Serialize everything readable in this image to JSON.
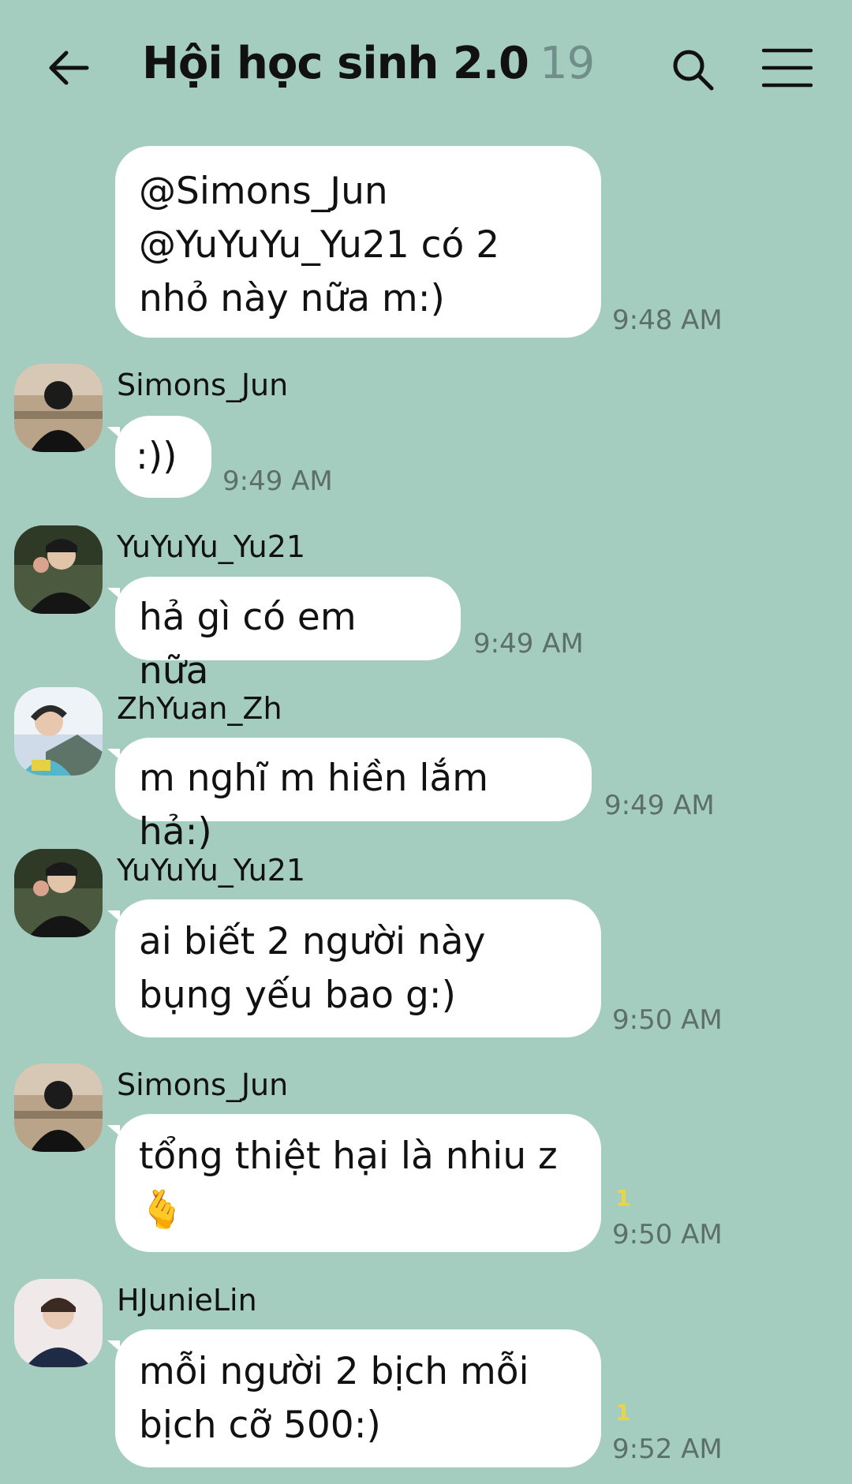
{
  "header": {
    "title": "Hội học sinh 2.0",
    "member_count": "19"
  },
  "messages": [
    {
      "text": "@Simons_Jun @YuYuYu_Yu21 có 2 nhỏ này nữa m:)",
      "time": "9:48 AM"
    },
    {
      "sender": "Simons_Jun",
      "text": ":))",
      "time": "9:49 AM"
    },
    {
      "sender": "YuYuYu_Yu21",
      "text": "hả gì có em nữa",
      "time": "9:49 AM"
    },
    {
      "sender": "ZhYuan_Zh",
      "text": "m nghĩ m hiền lắm hả:)",
      "time": "9:49 AM"
    },
    {
      "sender": "YuYuYu_Yu21",
      "text": "ai biết 2 người này bụng yếu bao g:)",
      "time": "9:50 AM"
    },
    {
      "sender": "Simons_Jun",
      "text": "tổng thiệt hại là nhiu z",
      "emoji": "🫰",
      "read": "1",
      "time": "9:50 AM"
    },
    {
      "sender": "HJunieLin",
      "text": "mỗi người 2 bịch mỗi bịch cỡ 500:)",
      "read": "1",
      "time": "9:52 AM"
    }
  ],
  "colors": {
    "background": "#a5cdbf",
    "bubble": "#ffffff",
    "read_marker": "#e8d44a"
  },
  "icons": [
    "back-arrow-icon",
    "search-icon",
    "hamburger-menu-icon"
  ]
}
